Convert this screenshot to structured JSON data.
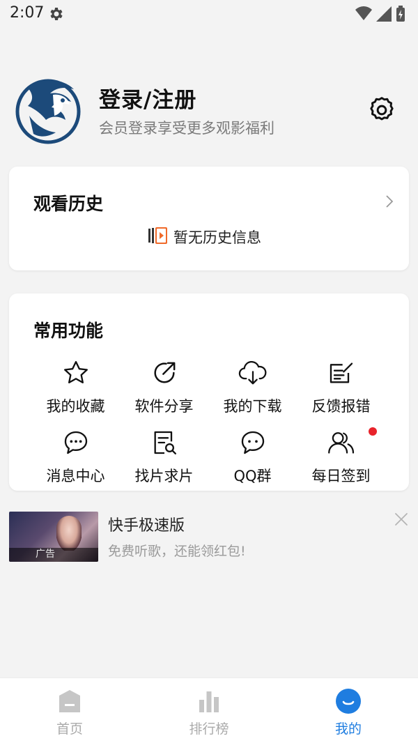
{
  "status_bar": {
    "time": "2:07"
  },
  "profile": {
    "title": "登录/注册",
    "subtitle": "会员登录享受更多观影福利"
  },
  "history": {
    "title": "观看历史",
    "empty_text": "暂无历史信息"
  },
  "functions": {
    "title": "常用功能",
    "items": [
      {
        "label": "我的收藏",
        "icon": "star-icon"
      },
      {
        "label": "软件分享",
        "icon": "share-icon"
      },
      {
        "label": "我的下载",
        "icon": "cloud-download-icon"
      },
      {
        "label": "反馈报错",
        "icon": "edit-note-icon"
      },
      {
        "label": "消息中心",
        "icon": "chat-bubble-icon"
      },
      {
        "label": "找片求片",
        "icon": "search-document-icon"
      },
      {
        "label": "QQ群",
        "icon": "chat-group-icon"
      },
      {
        "label": "每日签到",
        "icon": "users-icon",
        "badge": true
      }
    ]
  },
  "ad": {
    "title": "快手极速版",
    "description": "免费听歌，还能领红包!",
    "tag": "广告"
  },
  "bottom_nav": {
    "items": [
      {
        "label": "首页",
        "icon": "home-icon",
        "active": false
      },
      {
        "label": "排行榜",
        "icon": "bar-chart-icon",
        "active": false
      },
      {
        "label": "我的",
        "icon": "smile-icon",
        "active": true
      }
    ]
  },
  "colors": {
    "accent": "#1f7de0",
    "badge": "#e8232b",
    "background": "#f3f3f3"
  }
}
